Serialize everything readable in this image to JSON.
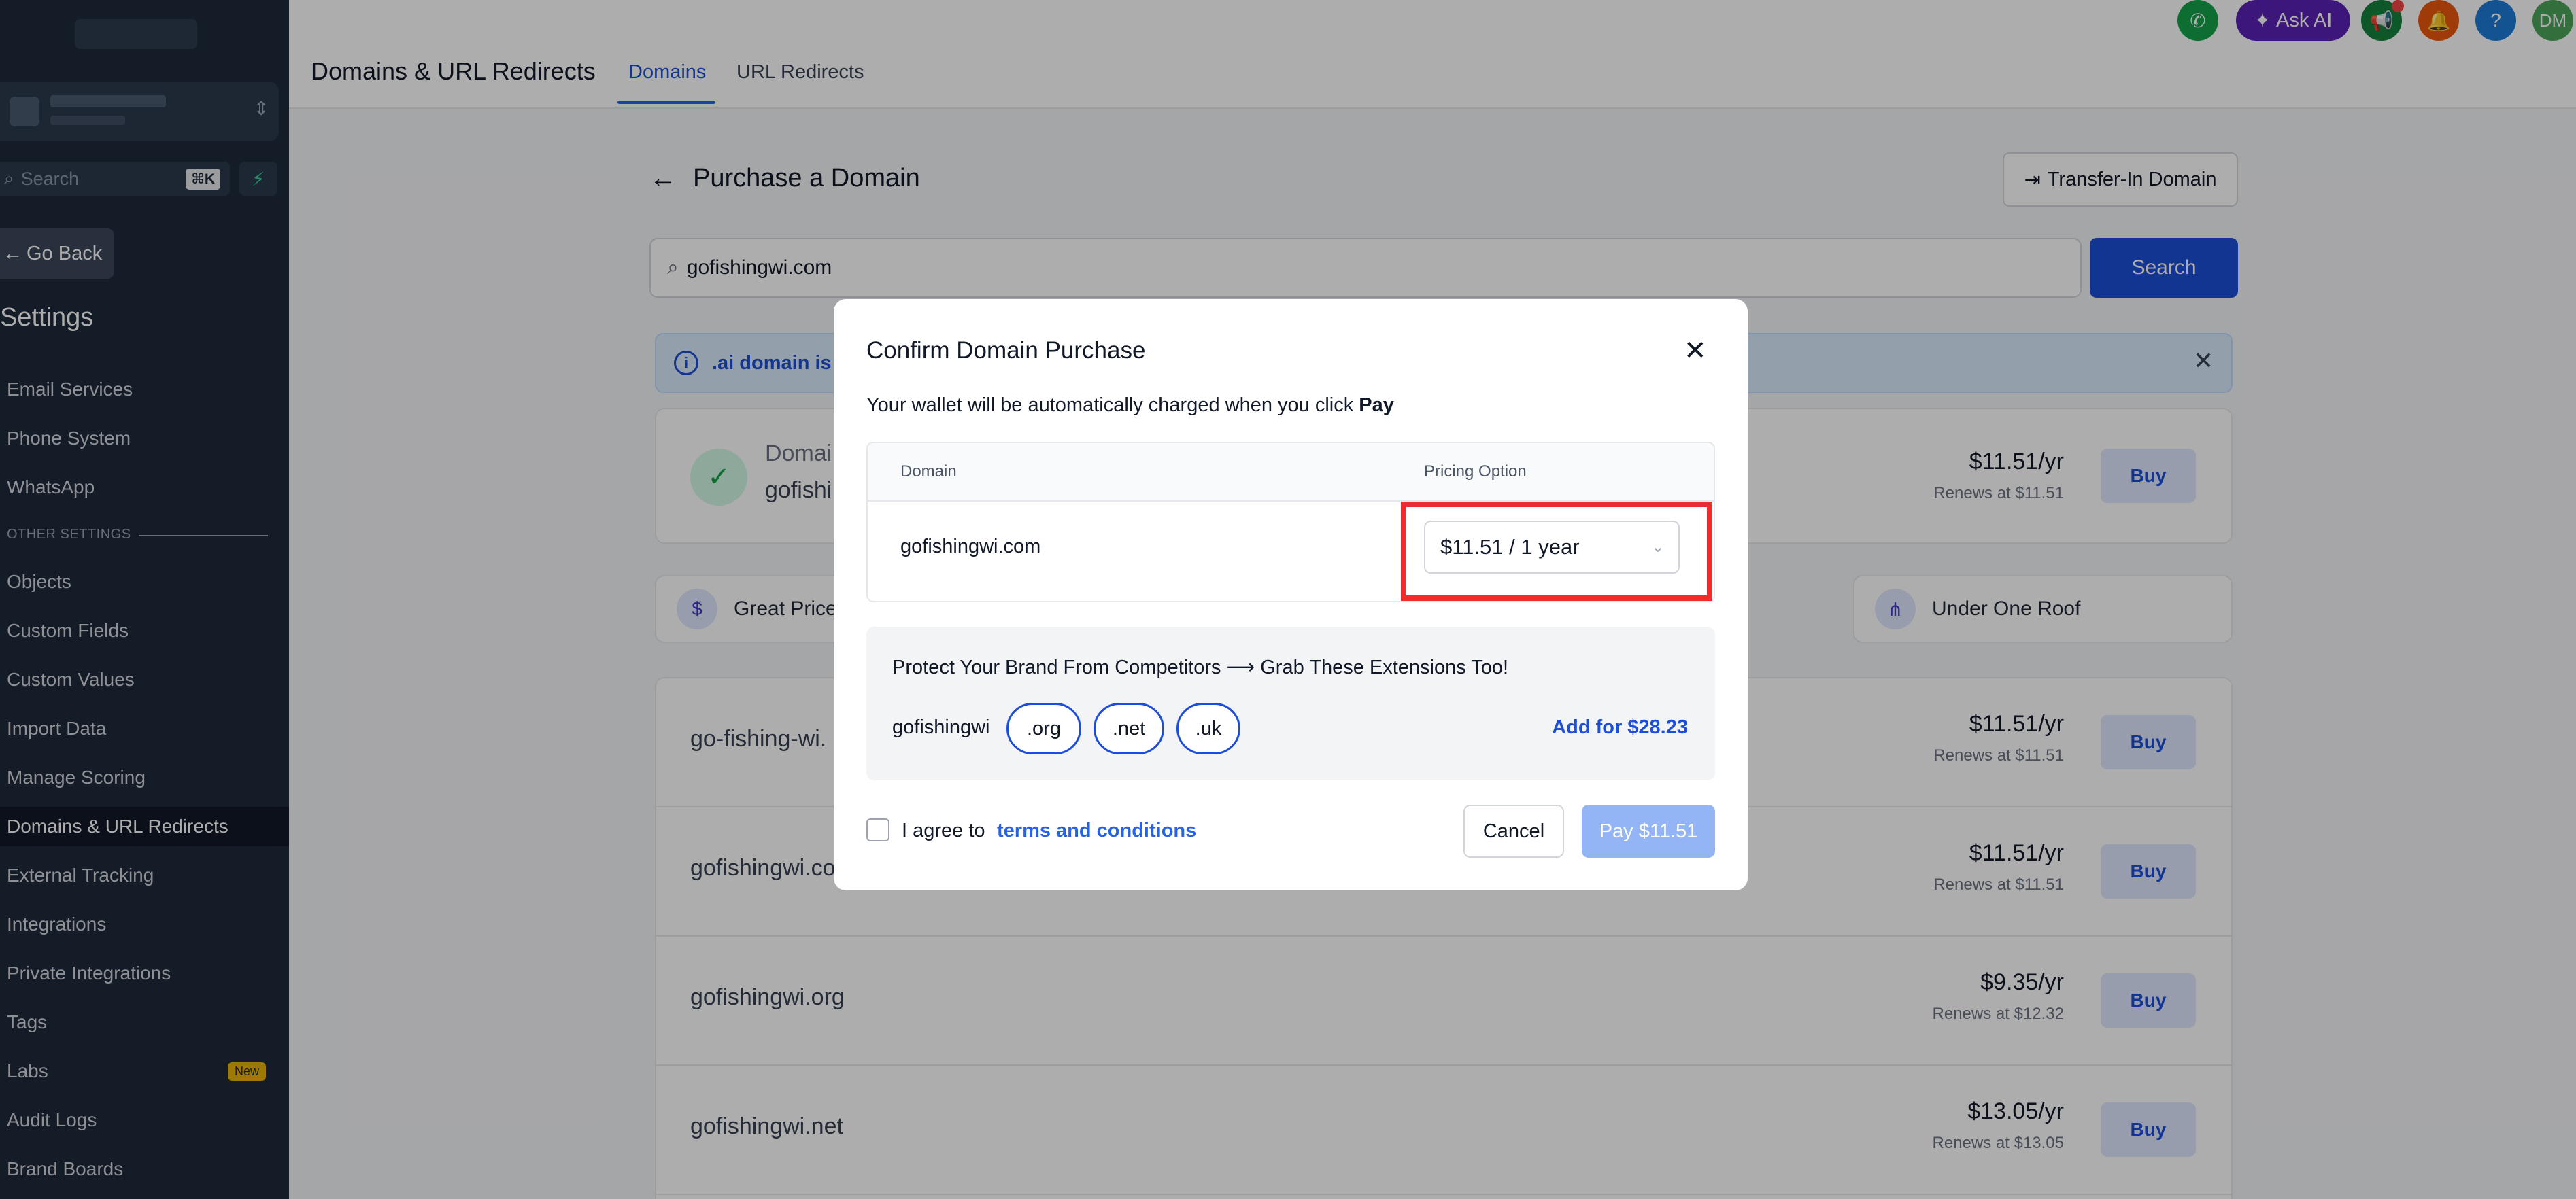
{
  "sidebar": {
    "search_placeholder": "Search",
    "search_shortcut": "⌘K",
    "go_back": "Go Back",
    "heading": "Settings",
    "items_top": [
      "Email Services",
      "Phone System",
      "WhatsApp"
    ],
    "group_label": "OTHER SETTINGS",
    "items": [
      "Objects",
      "Custom Fields",
      "Custom Values",
      "Import Data",
      "Manage Scoring",
      "Domains & URL Redirects",
      "External Tracking",
      "Integrations",
      "Private Integrations",
      "Tags",
      "Labs",
      "Audit Logs",
      "Brand Boards"
    ],
    "active_item": "Domains & URL Redirects",
    "labs_badge": "New"
  },
  "header": {
    "title": "Domains & URL Redirects",
    "tabs": [
      {
        "label": "Domains",
        "active": true
      },
      {
        "label": "URL Redirects",
        "active": false
      }
    ],
    "ask_ai": "Ask AI",
    "help": "?",
    "user_initials": "DM",
    "colors": {
      "phone": "#16a34a",
      "ask_ai": "#5b21b6",
      "announce": "#15803d",
      "bell": "#ea580c",
      "help": "#1d7bd8",
      "avatar": "#4ca35a"
    }
  },
  "main": {
    "purchase_title": "Purchase a Domain",
    "transfer_btn": "Transfer-In Domain",
    "search_value": "gofishingwi.com",
    "search_btn": "Search",
    "info_text": ".ai domain is",
    "available": {
      "label": "Domai",
      "name": "gofishi",
      "price": "$11.51/yr",
      "renews": "Renews at $11.51",
      "buy": "Buy"
    },
    "features": [
      "Great Price",
      "Under One Roof"
    ],
    "results": [
      {
        "name": "go-fishing-wi.",
        "price": "$11.51/yr",
        "renews": "Renews at $11.51",
        "buy": "Buy"
      },
      {
        "name": "gofishingwi.co",
        "price": "$11.51/yr",
        "renews": "Renews at $11.51",
        "buy": "Buy"
      },
      {
        "name": "gofishingwi.org",
        "price": "$9.35/yr",
        "renews": "Renews at $12.32",
        "buy": "Buy"
      },
      {
        "name": "gofishingwi.net",
        "price": "$13.05/yr",
        "renews": "Renews at $13.05",
        "buy": "Buy"
      }
    ]
  },
  "modal": {
    "title": "Confirm Domain Purchase",
    "subtitle_prefix": "Your wallet will be automatically charged when you click ",
    "subtitle_bold": "Pay",
    "col_domain": "Domain",
    "col_pricing": "Pricing Option",
    "domain": "gofishingwi.com",
    "pricing_selected": "$11.51 / 1 year",
    "protect_title": "Protect Your Brand From Competitors ⟶ Grab These Extensions Too!",
    "protect_base": "gofishingwi",
    "extensions": [
      ".org",
      ".net",
      ".uk"
    ],
    "add_for": "Add for $28.23",
    "agree_prefix": "I agree to",
    "terms_link": "terms and conditions",
    "cancel": "Cancel",
    "pay": "Pay $11.51",
    "highlight_color": "#ef2b2b"
  }
}
